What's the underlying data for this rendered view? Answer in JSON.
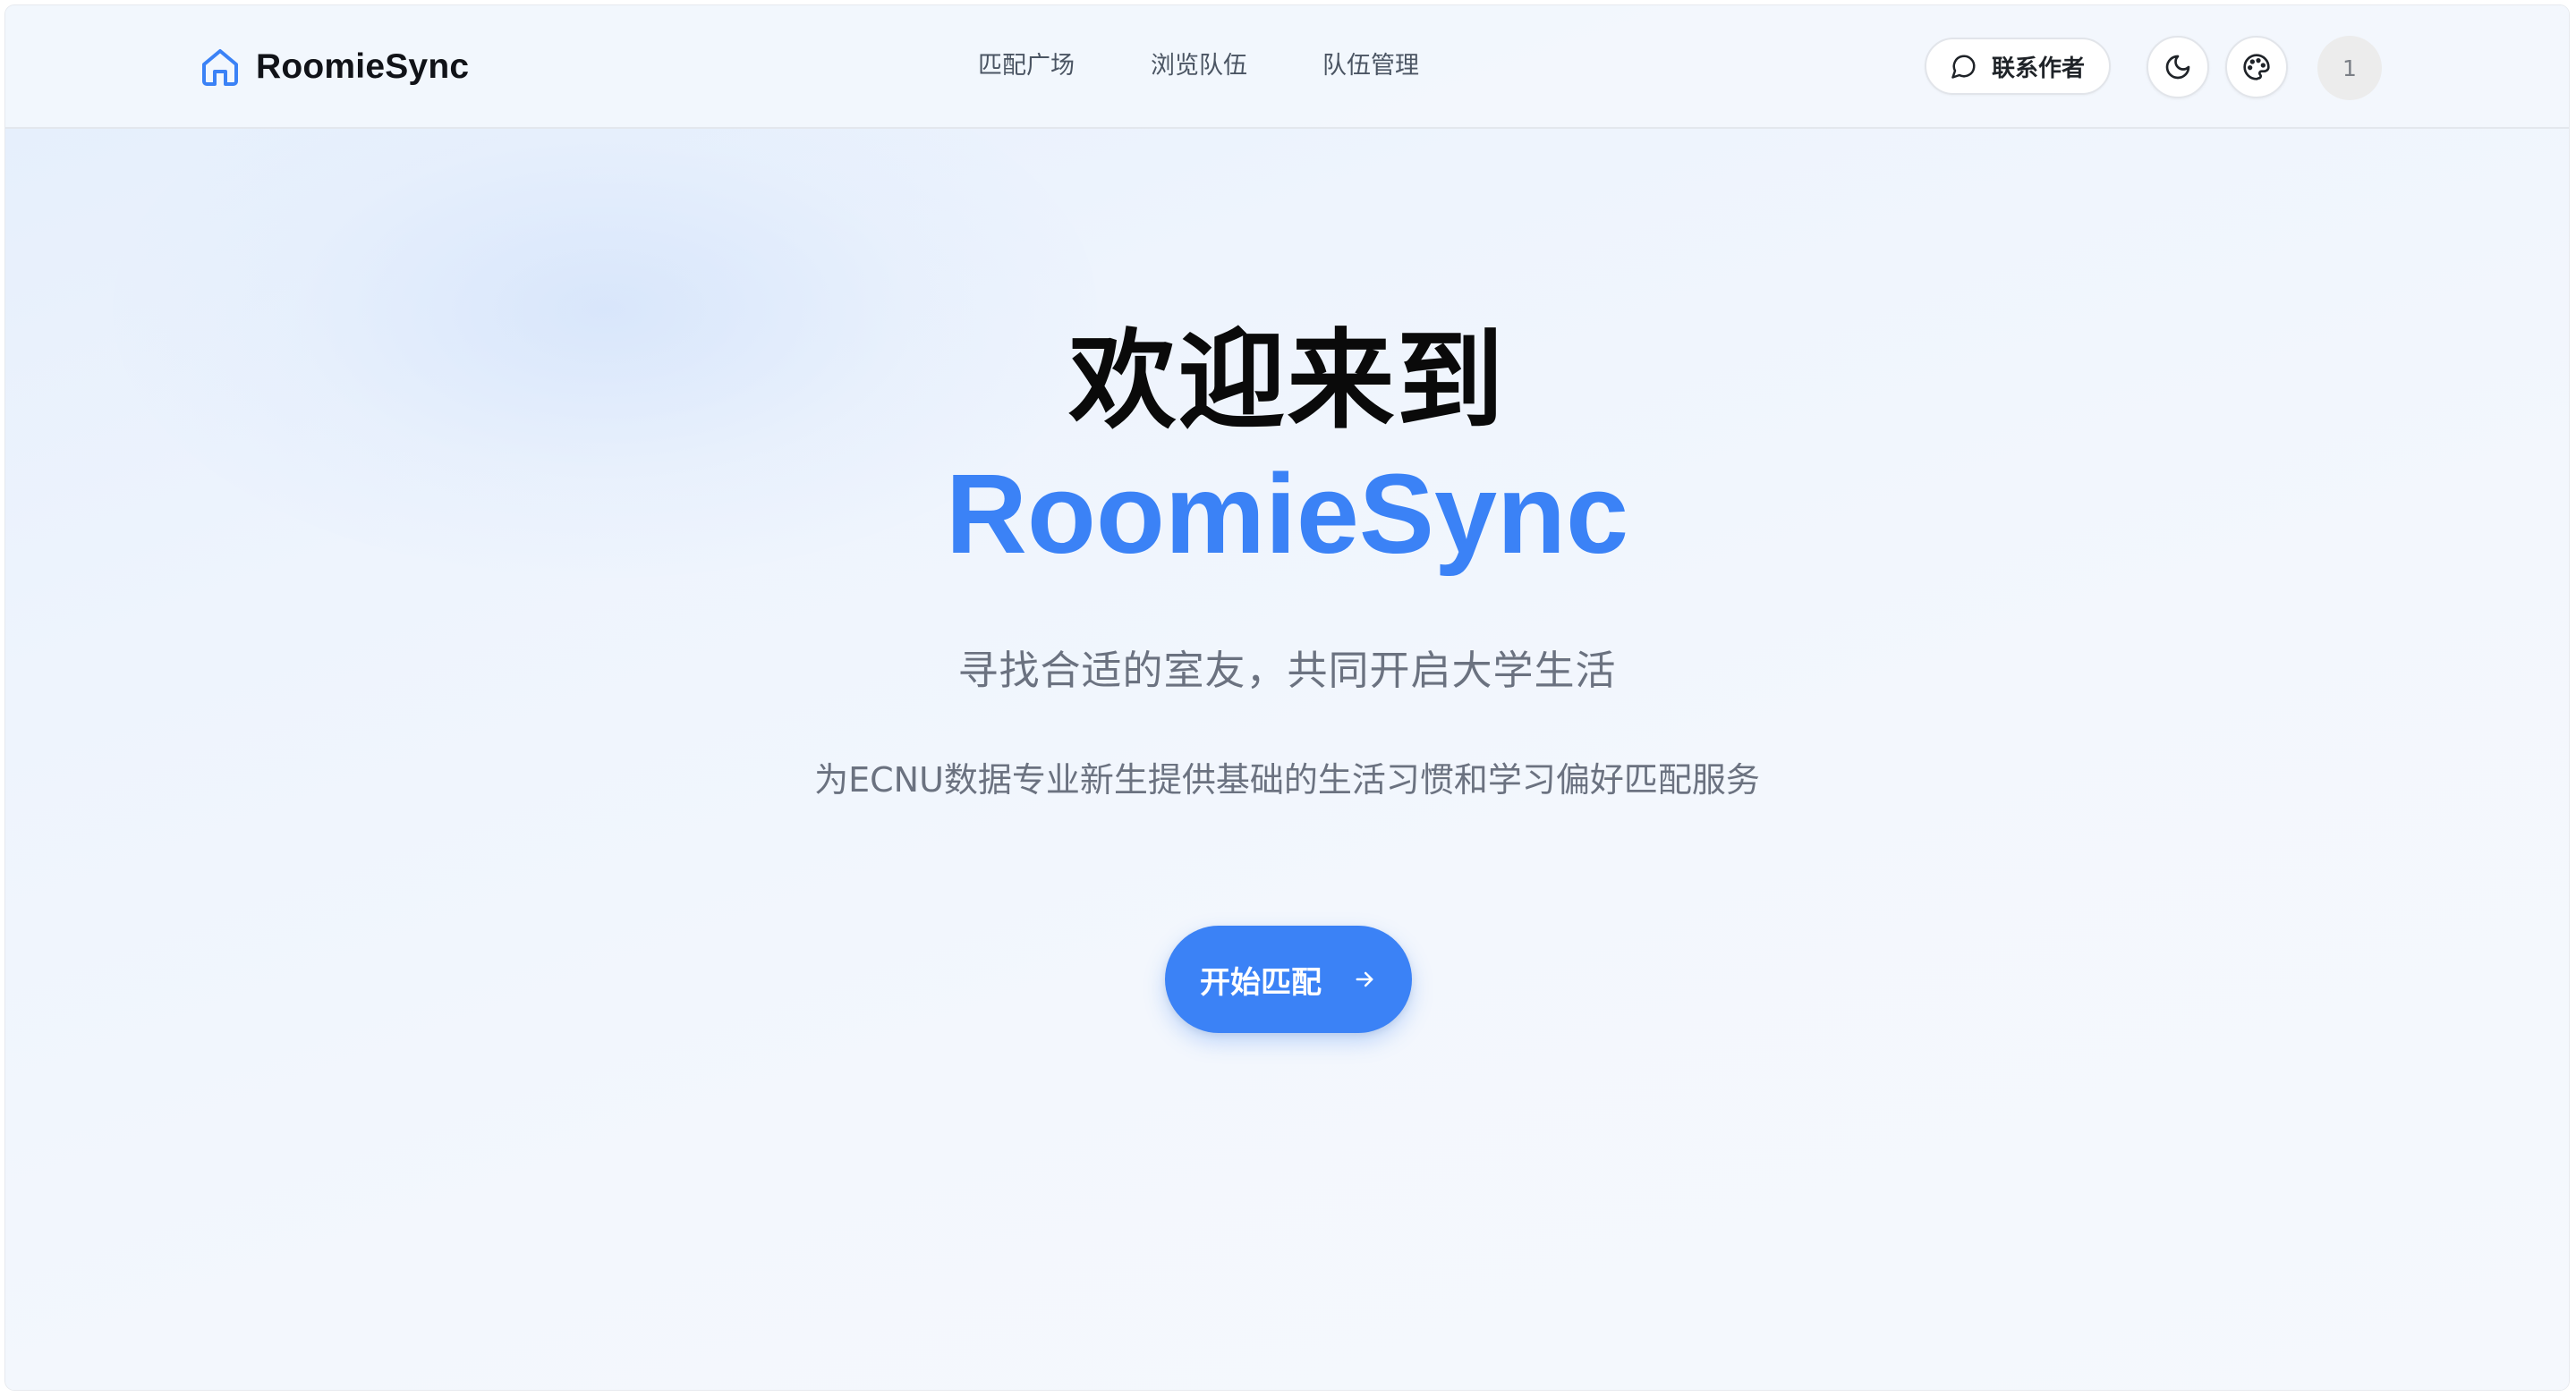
{
  "header": {
    "brand": {
      "name": "RoomieSync",
      "icon": "home-icon",
      "accent": "#3b82f6"
    },
    "nav": [
      {
        "label": "匹配广场"
      },
      {
        "label": "浏览队伍"
      },
      {
        "label": "队伍管理"
      }
    ],
    "contact": {
      "label": "联系作者",
      "icon": "chat-bubble-icon"
    },
    "theme_toggle": {
      "icon": "moon-icon"
    },
    "palette": {
      "icon": "palette-icon"
    },
    "avatar": {
      "text": "1"
    }
  },
  "hero": {
    "line1": "欢迎来到",
    "line2": "RoomieSync",
    "tagline": "寻找合适的室友，共同开启大学生活",
    "description": "为ECNU数据专业新生提供基础的生活习惯和学习偏好匹配服务",
    "cta": {
      "label": "开始匹配",
      "icon": "arrow-right-icon",
      "color": "#3b82f6"
    }
  }
}
